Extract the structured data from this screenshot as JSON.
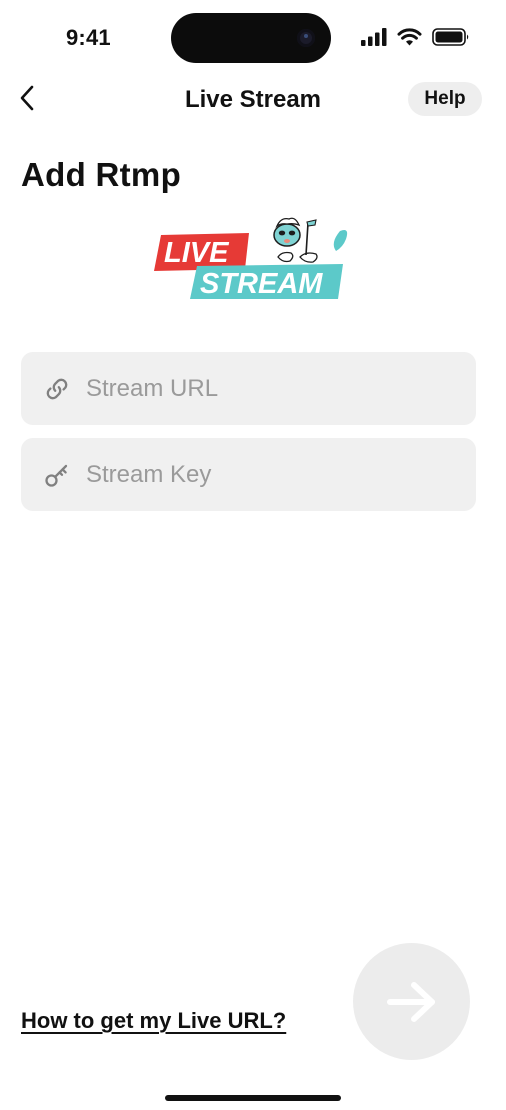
{
  "status_bar": {
    "time": "9:41",
    "icons": [
      "signal-bars-icon",
      "wifi-icon",
      "battery-icon"
    ]
  },
  "nav": {
    "back_icon": "chevron-left-icon",
    "title": "Live Stream",
    "help_label": "Help"
  },
  "page": {
    "title": "Add Rtmp"
  },
  "logo": {
    "line1": "LIVE",
    "line2": "STREAM",
    "colors": {
      "red": "#e63a36",
      "teal": "#5cc9c9"
    }
  },
  "form": {
    "stream_url": {
      "icon": "link-icon",
      "placeholder": "Stream URL",
      "value": ""
    },
    "stream_key": {
      "icon": "key-icon",
      "placeholder": "Stream Key",
      "value": ""
    }
  },
  "footer": {
    "help_link": "How to get my Live URL?",
    "next_icon": "arrow-right-icon",
    "next_disabled": true
  },
  "colors": {
    "field_bg": "#f0f0f0",
    "placeholder": "#9a9a9a",
    "button_disabled_bg": "#ececec",
    "text": "#111111"
  }
}
